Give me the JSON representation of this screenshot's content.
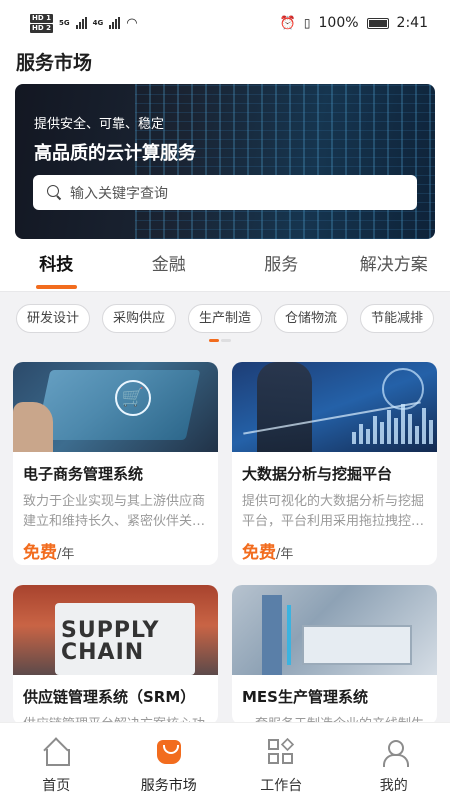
{
  "status_bar": {
    "hd1": "HD 1",
    "hd2": "HD 2",
    "net1": "5G",
    "net2": "4G",
    "battery": "100%",
    "time": "2:41"
  },
  "header": {
    "title": "服务市场"
  },
  "hero": {
    "subtitle": "提供安全、可靠、稳定",
    "title": "高品质的云计算服务",
    "search_placeholder": "输入关键字查询"
  },
  "tabs": [
    {
      "label": "科技",
      "active": true
    },
    {
      "label": "金融",
      "active": false
    },
    {
      "label": "服务",
      "active": false
    },
    {
      "label": "解决方案",
      "active": false
    }
  ],
  "chips": [
    "研发设计",
    "采购供应",
    "生产制造",
    "仓储物流",
    "节能减排"
  ],
  "cards": [
    {
      "title": "电子商务管理系统",
      "desc": "致力于企业实现与其上游供应商建立和维持长久、紧密伙伴关…",
      "price_label": "免费",
      "price_unit": "/年",
      "image": "ecommerce-cart-image"
    },
    {
      "title": "大数据分析与挖掘平台",
      "desc": "提供可视化的大数据分析与挖掘平台，平台利用采用拖拉拽控…",
      "price_label": "免费",
      "price_unit": "/年",
      "image": "bigdata-chart-image"
    },
    {
      "title": "供应链管理系统（SRM）",
      "desc": "供应链管理平台解决方案核心功",
      "image": "supply-chain-image",
      "image_text": "SUPPLY CHAIN"
    },
    {
      "title": "MES生产管理系统",
      "desc": "一套服务于制造企业的产线制生",
      "image": "factory-robot-image"
    }
  ],
  "bottom_nav": [
    {
      "label": "首页",
      "icon": "home-icon"
    },
    {
      "label": "服务市场",
      "icon": "market-bag-icon",
      "active": true
    },
    {
      "label": "工作台",
      "icon": "workbench-grid-icon"
    },
    {
      "label": "我的",
      "icon": "profile-icon"
    }
  ],
  "colors": {
    "accent": "#f26c1e",
    "background": "#f2f2f4"
  }
}
